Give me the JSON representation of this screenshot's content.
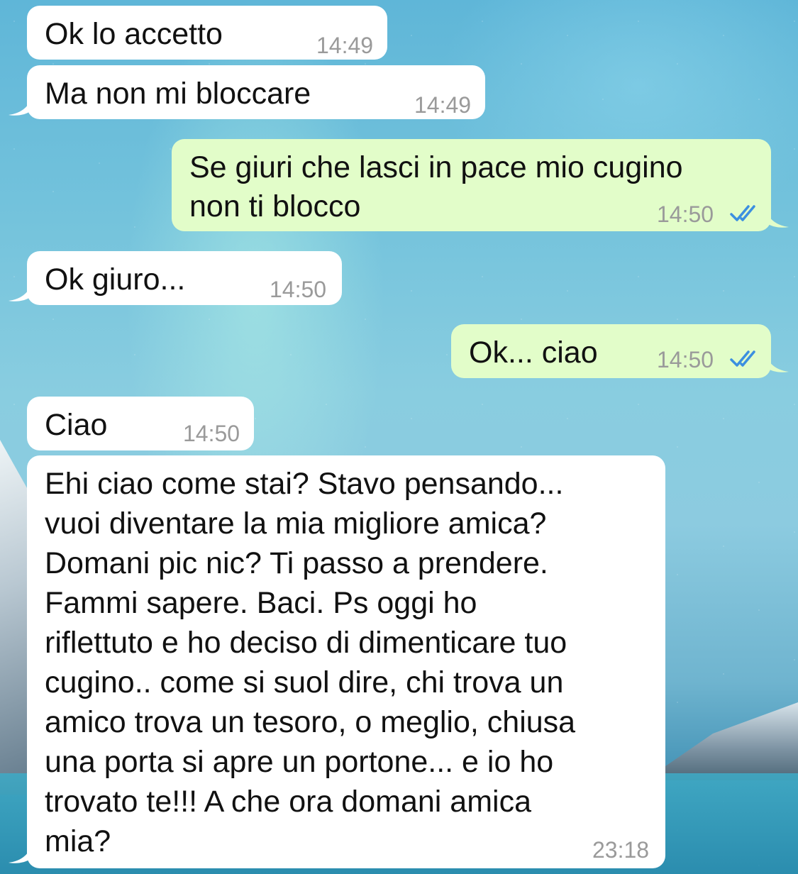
{
  "messages": [
    {
      "text": "Ok lo accetto",
      "time": "14:49",
      "direction": "incoming"
    },
    {
      "text": "Ma non mi bloccare",
      "time": "14:49",
      "direction": "incoming"
    },
    {
      "text_lines": [
        "Se giuri che lasci in pace mio cugino",
        "non ti blocco"
      ],
      "time": "14:50",
      "direction": "outgoing",
      "status": "read"
    },
    {
      "text": "Ok giuro...",
      "time": "14:50",
      "direction": "incoming"
    },
    {
      "text": "Ok... ciao",
      "time": "14:50",
      "direction": "outgoing",
      "status": "read"
    },
    {
      "text": "Ciao",
      "time": "14:50",
      "direction": "incoming"
    },
    {
      "text_lines": [
        "Ehi ciao come stai? Stavo pensando...",
        "vuoi diventare la mia migliore amica?",
        "Domani pic nic? Ti passo a prendere.",
        "Fammi sapere. Baci. Ps oggi ho",
        "riflettuto e ho deciso di dimenticare tuo",
        "cugino.. come si suol dire, chi trova un",
        "amico trova un tesoro, o meglio, chiusa",
        "una porta si apre un portone... e io ho",
        "trovato te!!! A che ora domani amica",
        "mia?"
      ],
      "time": "23:18",
      "direction": "incoming"
    }
  ],
  "colors": {
    "incoming_bubble": "#ffffff",
    "outgoing_bubble": "#e2fdc9",
    "read_ticks": "#3b8fe0",
    "timestamp": "#9a9a9a"
  },
  "icons": {
    "read_receipt": "double-check-icon"
  }
}
